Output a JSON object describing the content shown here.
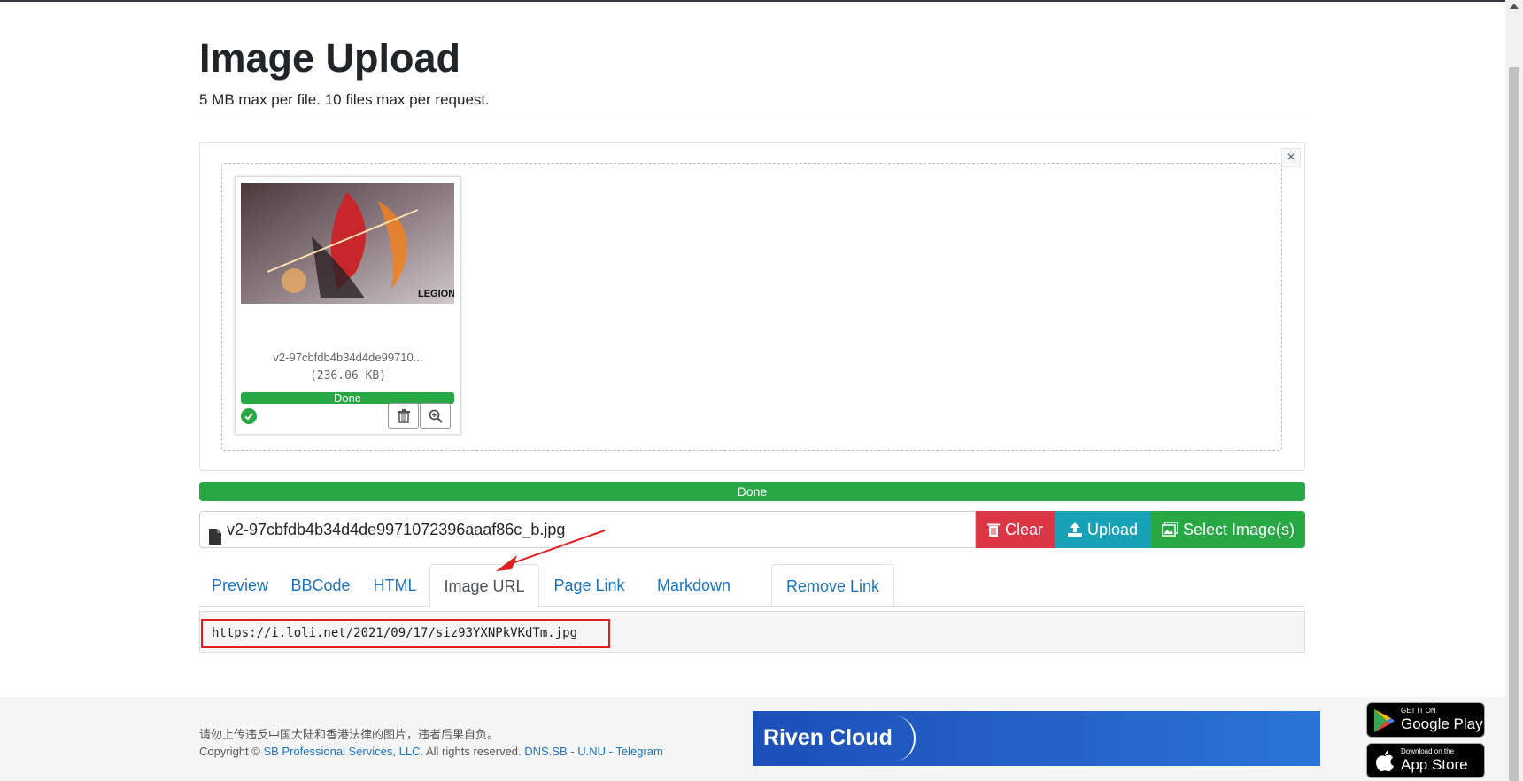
{
  "page": {
    "title": "Image Upload",
    "subtitle": "5 MB max per file. 10 files max per request."
  },
  "upload_panel": {
    "close_label": "×",
    "thumbnail": {
      "file_name": "v2-97cbfdb4b34d4de99710...",
      "file_size": "(236.06 KB)",
      "status": "Done",
      "overlay_text": "LEGION"
    }
  },
  "progress": {
    "label": "Done",
    "value": 1.0
  },
  "file_row": {
    "file_name": "v2-97cbfdb4b34d4de9971072396aaaf86c_b.jpg",
    "clear_label": "Clear",
    "upload_label": "Upload",
    "select_label": "Select Image(s)"
  },
  "tabs": [
    {
      "label": "Preview"
    },
    {
      "label": "BBCode"
    },
    {
      "label": "HTML"
    },
    {
      "label": "Image URL"
    },
    {
      "label": "Page Link"
    },
    {
      "label": "Markdown"
    },
    {
      "label": "Remove Link"
    }
  ],
  "active_tab": "Image URL",
  "output": {
    "url": "https://i.loli.net/2021/09/17/siz93YXNPkVKdTm.jpg"
  },
  "footer": {
    "notice": "请勿上传违反中国大陆和香港法律的图片，违者后果自负。",
    "copyright_prefix": "Copyright ©",
    "company": "SB Professional Services, LLC.",
    "rights": "All rights reserved.",
    "links": [
      "DNS.SB",
      "U.NU",
      "Telegram"
    ],
    "separator": " - ",
    "banner_text": "Riven Cloud",
    "google_play_small": "GET IT ON",
    "google_play_big": "Google Play",
    "app_store_small": "Download on the",
    "app_store_big": "App Store"
  },
  "colors": {
    "success": "#28a745",
    "danger": "#dc3545",
    "info": "#17a2b8",
    "link": "#1a73c8",
    "annotation": "#e02020"
  }
}
